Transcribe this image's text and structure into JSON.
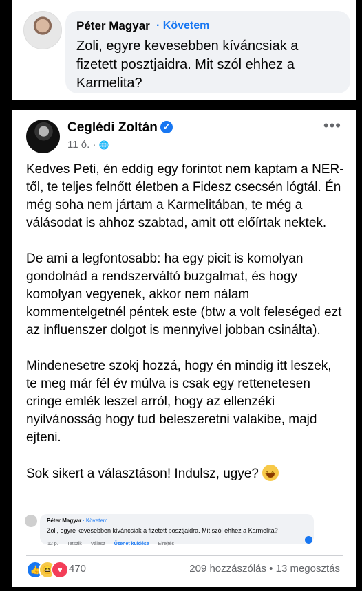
{
  "top_comment": {
    "author": "Péter Magyar",
    "follow": "· Követem",
    "text": "Zoli, egyre kevesebben kíváncsiak a fizetett posztjaidra. Mit szól ehhez a Karmelita?"
  },
  "post": {
    "author": "Ceglédi Zoltán",
    "verified_icon": "✓",
    "time": "11 ó. · ",
    "globe_icon": "🌐",
    "more_icon": "•••",
    "paragraphs": [
      "Kedves Peti, én eddig egy forintot nem kaptam a NER-től, te teljes felnőtt életben a Fidesz csecsén lógtál. Én még soha nem jártam a Karmelitában, te még a válásodat is ahhoz szabtad, amit ott előírtak nektek.",
      "De ami a legfontosabb: ha egy picit is komolyan gondolnád a rendszerváltó buzgalmat, és hogy komolyan vegyenek, akkor nem nálam kommentelgetnél péntek este (btw a volt feleséged ezt az influenszer dolgot is mennyivel jobban csinálta).",
      "Mindenesetre szokj hozzá, hogy én mindig itt leszek, te meg már fél év múlva is csak egy rettenetesen cringe emlék leszel arról, hogy az ellenzéki nyilvánosság hogy tud beleszeretni valakibe, majd ejteni.",
      "Sok sikert a választáson! Indulsz, ugye?"
    ],
    "emoji": "😆"
  },
  "embedded_comment": {
    "author": "Péter Magyar",
    "follow": "· Követem",
    "text": "Zoli, egyre kevesebben kíváncsiak a fizetett posztjaidra. Mit szól ehhez a Karmelita?",
    "time": "12 p.",
    "actions": [
      "Tetszik",
      "Válasz",
      "Üzenet küldése",
      "Elrejtés"
    ]
  },
  "reactions": {
    "icons": [
      "like",
      "haha",
      "love"
    ],
    "count": "470",
    "comments": "209 hozzászólás",
    "shares": "13 megosztás",
    "separator": " • "
  }
}
